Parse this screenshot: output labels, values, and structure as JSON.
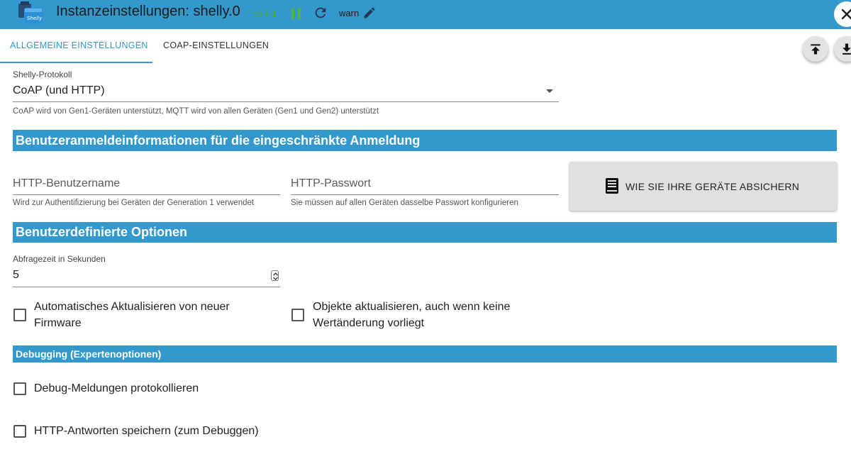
{
  "header": {
    "title": "Instanzeinstellungen: shelly.0",
    "version": "v6.6.1",
    "log_level": "warn",
    "logo_icon": "shelly-logo-icon",
    "pause_icon": "pause-icon",
    "reload_icon": "reload-icon",
    "edit_icon": "pencil-icon",
    "close_icon": "close-icon"
  },
  "tabs": [
    {
      "label": "ALLGEMEINE EINSTELLUNGEN",
      "active": true
    },
    {
      "label": "COAP-EINSTELLUNGEN",
      "active": false
    }
  ],
  "fabs": {
    "upload_icon": "upload-to-top-icon",
    "download_icon": "download-icon"
  },
  "protocol": {
    "label": "Shelly-Protokoll",
    "value": "CoAP (und HTTP)",
    "helper": "CoAP wird von Gen1-Geräten unterstützt, MQTT wird von allen Geräten (Gen1 und Gen2) unterstützt"
  },
  "sections": {
    "credentials": "Benutzeranmeldeinformationen für die eingeschränkte Anmeldung",
    "custom": "Benutzerdefinierte Optionen",
    "debugging": "Debugging (Expertenoptionen)"
  },
  "credentials": {
    "username_placeholder": "HTTP-Benutzername",
    "username_helper": "Wird zur Authentifizierung bei Geräten der Generation 1 verwendet",
    "password_placeholder": "HTTP-Passwort",
    "password_helper": "Sie müssen auf allen Geräten dasselbe Passwort konfigurieren",
    "guide_button": "WIE SIE IHRE GERÄTE ABSICHERN",
    "guide_icon": "book-icon"
  },
  "custom": {
    "poll_label": "Abfragezeit in Sekunden",
    "poll_value": "5",
    "auto_update_label": "Automatisches Aktualisieren von neuer Firmware",
    "auto_update_checked": false,
    "update_unchanged_label": "Objekte aktualisieren, auch wenn keine Wertänderung vorliegt",
    "update_unchanged_checked": false
  },
  "debugging": {
    "log_debug_label": "Debug-Meldungen protokollieren",
    "log_debug_checked": false,
    "save_http_label": "HTTP-Antworten speichern (zum Debuggen)",
    "save_http_checked": false
  },
  "colors": {
    "primary": "#3399cc",
    "version_green": "#3fae3f"
  }
}
